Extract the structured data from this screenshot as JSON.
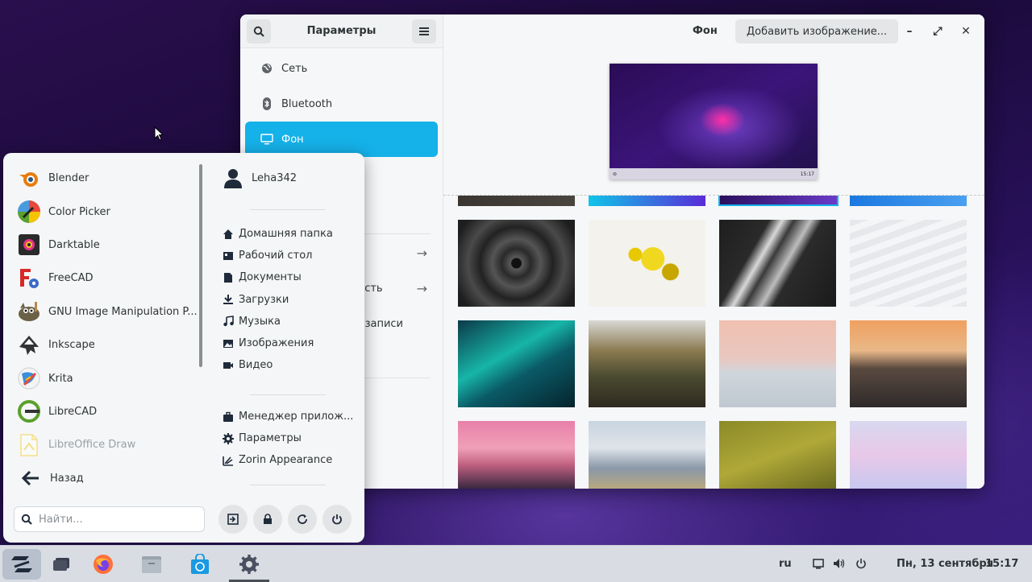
{
  "settings": {
    "sidebar_title": "Параметры",
    "nav_items": [
      {
        "label": "Сеть",
        "icon": "globe-icon"
      },
      {
        "label": "Bluetooth",
        "icon": "bluetooth-icon"
      },
      {
        "label": "Фон",
        "icon": "monitor-icon",
        "active": true
      }
    ],
    "partial_rows": [
      {
        "label": "",
        "arrow": "→"
      },
      {
        "label": "ость",
        "arrow": "→"
      },
      {
        "label": "записи",
        "arrow": ""
      }
    ],
    "page_title": "Фон",
    "add_image_label": "Добавить изображение...",
    "window_controls": [
      "–",
      "⤢",
      "✕"
    ],
    "preview_clock": "15:17"
  },
  "menu": {
    "apps": [
      {
        "label": "Blender",
        "icon": "blender-icon",
        "color": "#e87d0d"
      },
      {
        "label": "Color Picker",
        "icon": "color-picker-icon",
        "color": "#e64a3c"
      },
      {
        "label": "Darktable",
        "icon": "darktable-icon",
        "color": "#333333"
      },
      {
        "label": "FreeCAD",
        "icon": "freecad-icon",
        "color": "#d62a2a"
      },
      {
        "label": "GNU Image Manipulation P...",
        "icon": "gimp-icon",
        "color": "#6b6147"
      },
      {
        "label": "Inkscape",
        "icon": "inkscape-icon",
        "color": "#333333"
      },
      {
        "label": "Krita",
        "icon": "krita-icon",
        "color": "#3c8dde"
      },
      {
        "label": "LibreCAD",
        "icon": "librecad-icon",
        "color": "#5aa02c"
      },
      {
        "label": "LibreOffice Draw",
        "icon": "libreoffice-draw-icon",
        "color": "#f5c400",
        "dim": true
      }
    ],
    "back_label": "Назад",
    "user_name": "Leha342",
    "places": [
      {
        "label": "Домашняя папка",
        "icon": "home-icon"
      },
      {
        "label": "Рабочий стол",
        "icon": "desktop-icon"
      },
      {
        "label": "Документы",
        "icon": "document-icon"
      },
      {
        "label": "Загрузки",
        "icon": "download-icon"
      },
      {
        "label": "Музыка",
        "icon": "music-icon"
      },
      {
        "label": "Изображения",
        "icon": "image-icon"
      },
      {
        "label": "Видео",
        "icon": "video-icon"
      }
    ],
    "system": [
      {
        "label": "Менеджер прилож...",
        "icon": "briefcase-icon"
      },
      {
        "label": "Параметры",
        "icon": "gear-icon"
      },
      {
        "label": "Zorin Appearance",
        "icon": "appearance-icon"
      }
    ],
    "search_placeholder": "Найти...",
    "actions": [
      "logout-icon",
      "lock-icon",
      "restart-icon",
      "power-icon"
    ]
  },
  "taskbar": {
    "language": "ru",
    "date": "Пн, 13 сентября",
    "time": "15:17"
  },
  "colors": {
    "accent": "#15b1e9",
    "taskbar": "#d9dde3"
  }
}
